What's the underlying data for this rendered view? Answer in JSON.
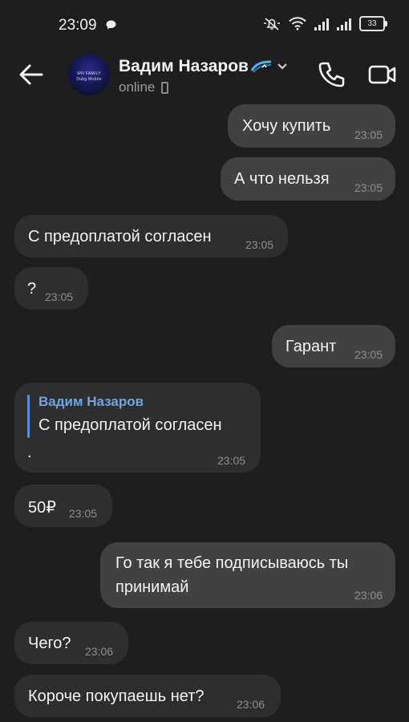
{
  "status_bar": {
    "time": "23:09",
    "battery": "33"
  },
  "header": {
    "contact_name": "Вадим Назаров",
    "presence": "online",
    "avatar_text_1": "WN FAMILY",
    "avatar_text_2": "Dubg Mobile"
  },
  "messages": [
    {
      "direction": "out",
      "text": "Хочу купить",
      "time": "23:05"
    },
    {
      "direction": "out",
      "text": "А что нельзя",
      "time": "23:05"
    },
    {
      "direction": "in",
      "text": "С предоплатой согласен",
      "time": "23:05"
    },
    {
      "direction": "in",
      "text": "?",
      "time": "23:05"
    },
    {
      "direction": "out",
      "text": "Гарант",
      "time": "23:05"
    },
    {
      "direction": "in",
      "reply_author": "Вадим Назаров",
      "reply_text": "С предоплатой согласен",
      "text": ".",
      "time": "23:05"
    },
    {
      "direction": "in",
      "text": "50₽",
      "time": "23:05"
    },
    {
      "direction": "out",
      "text_line1": "Го так я тебе подписываюсь ты",
      "text_line2": "принимай",
      "time": "23:06"
    },
    {
      "direction": "in",
      "text": "Чего?",
      "time": "23:06"
    },
    {
      "direction": "in",
      "text": "Короче покупаешь нет?",
      "time": "23:06"
    }
  ],
  "colors": {
    "background": "#1e1e1e",
    "incoming_bubble": "#2e2e2e",
    "outgoing_bubble": "#414141",
    "reply_accent": "#6ea5e6"
  }
}
